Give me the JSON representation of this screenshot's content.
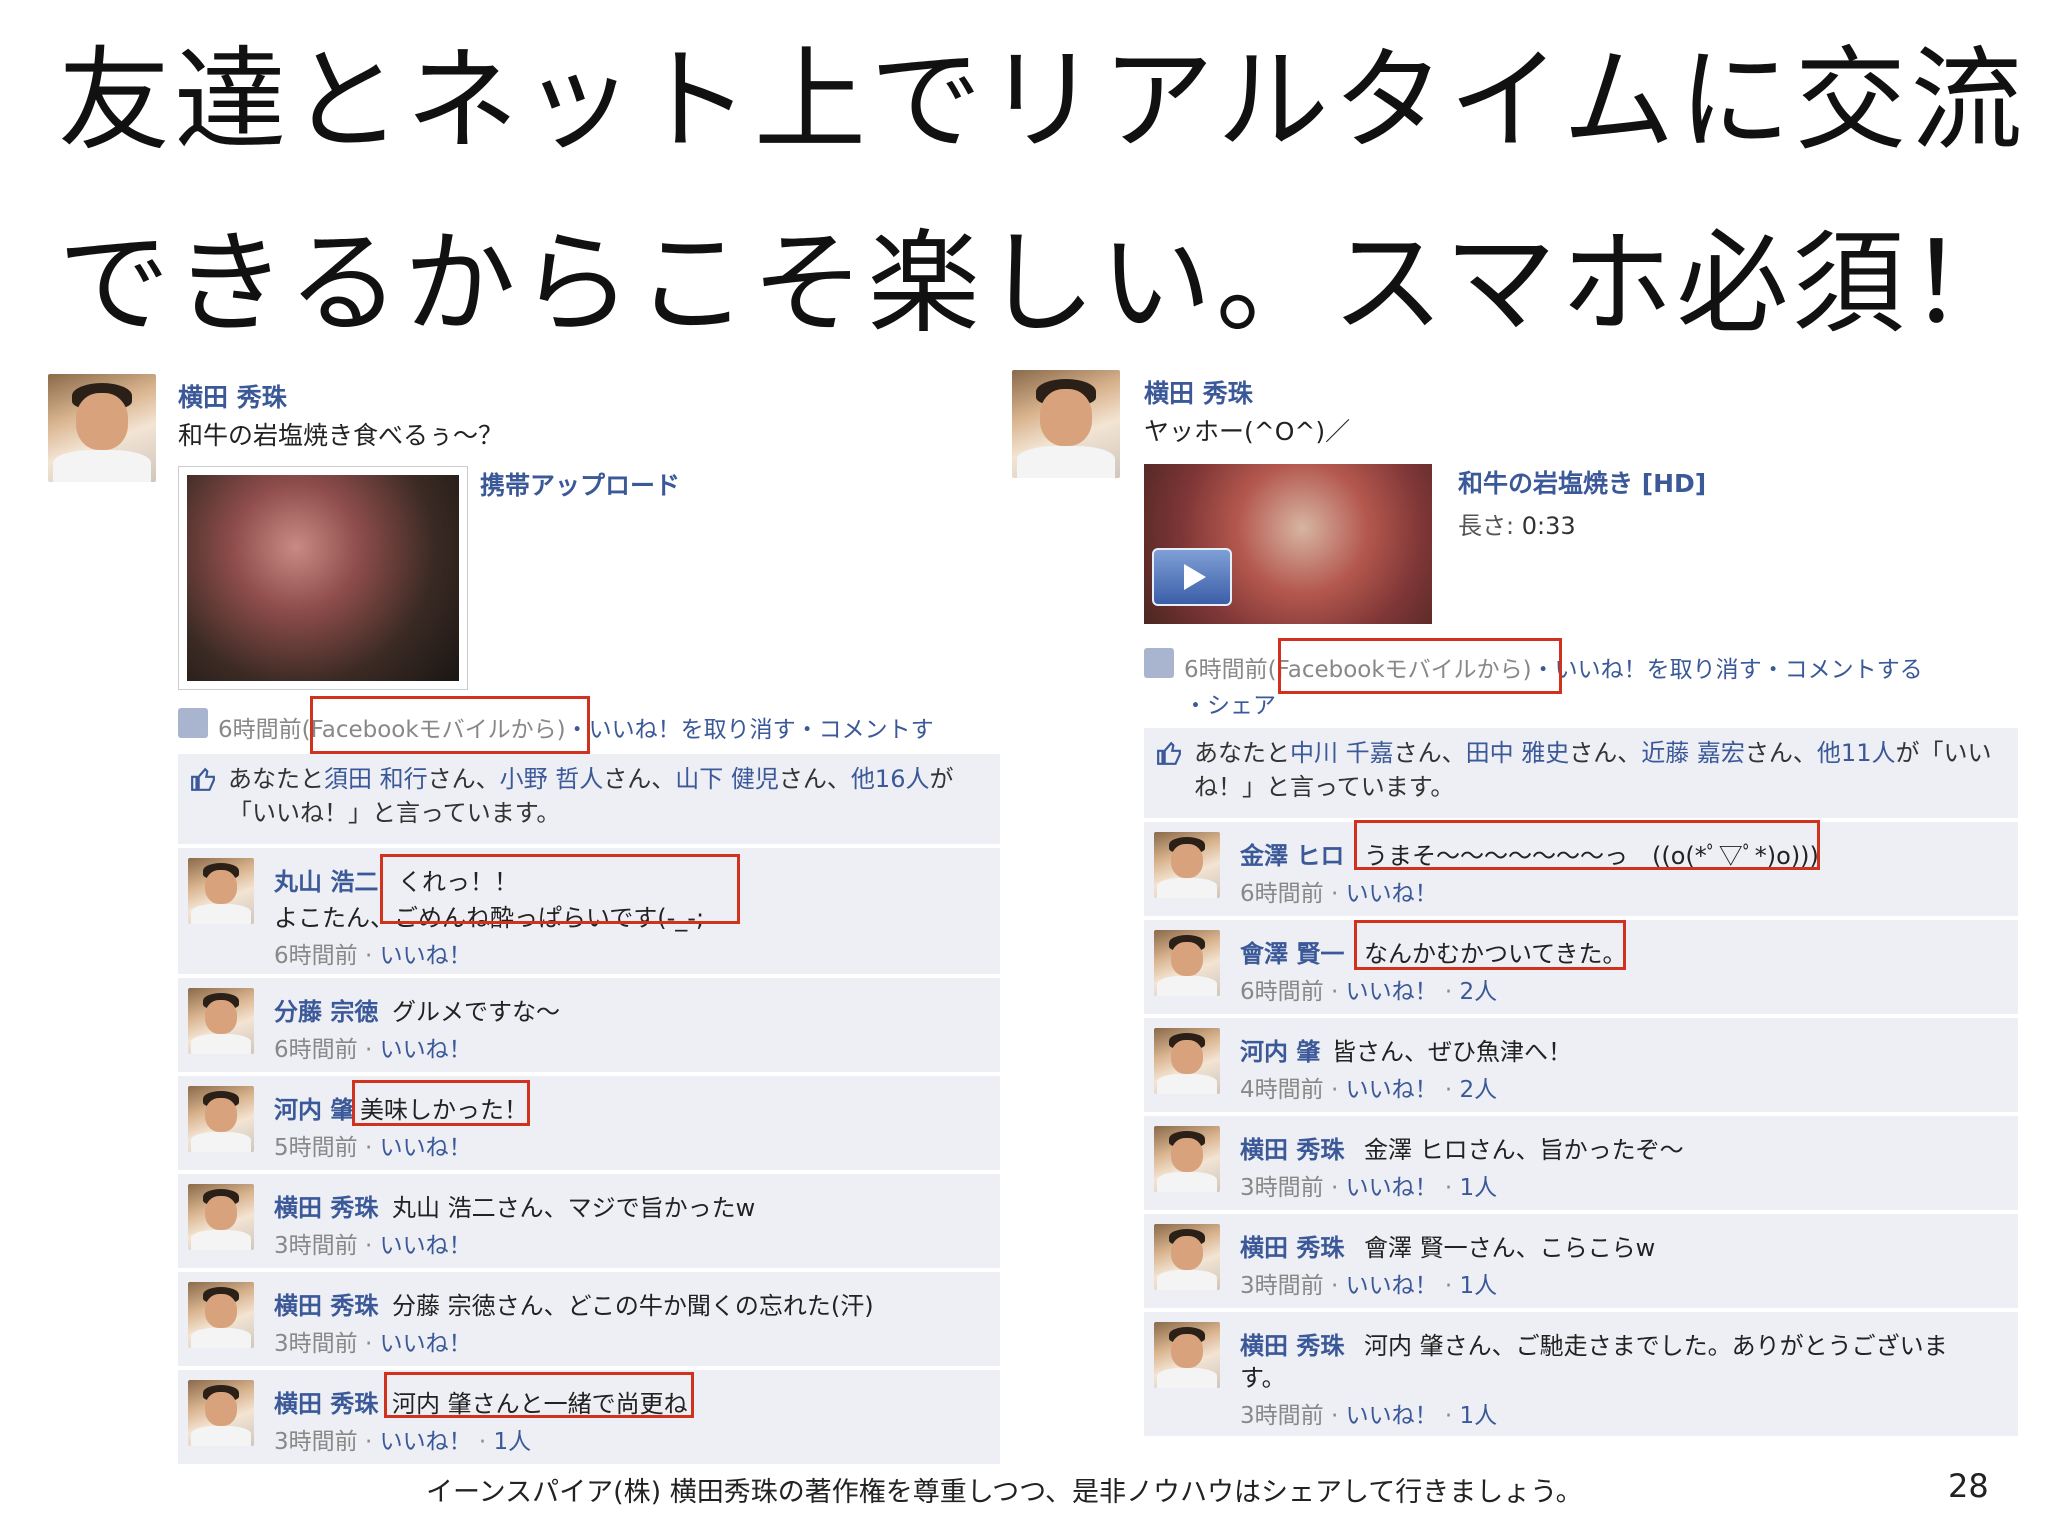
{
  "slide": {
    "title_line1": "友達とネット上でリアルタイムに交流",
    "title_line2": "できるからこそ楽しい。スマホ必須！",
    "footer": "イーンスパイア(株) 横田秀珠の著作権を尊重しつつ、是非ノウハウはシェアして行きましょう。",
    "page_number": "28"
  },
  "colors": {
    "link": "#3b5998",
    "highlight": "#d0321e",
    "comment_bg": "#edeff4"
  },
  "left_post": {
    "author": "横田 秀珠",
    "message": "和牛の岩塩焼き食べるぅ～？",
    "attachment_label": "携帯アップロード",
    "time": "6時間前",
    "via": "(Facebookモバイルから)",
    "actions": "・いいね！を取り消す・コメントす",
    "likes": {
      "prefix": "あなたと",
      "name1": "須田 和行",
      "sep1": "さん、",
      "name2": "小野 哲人",
      "sep2": "さん、",
      "name3": "山下 健児",
      "sep3": "さん、",
      "others": "他16人",
      "suffix": "が「いいね！」と言っています。"
    },
    "comments": [
      {
        "name": "丸山 浩二",
        "text": "くれっ！！",
        "text2": "よこたん、ごめんね酔っぱらいです(-_-;",
        "meta_time": "6時間前",
        "meta_like": "いいね！",
        "meta_count": ""
      },
      {
        "name": "分藤 宗徳",
        "text": "グルメですな～",
        "meta_time": "6時間前",
        "meta_like": "いいね！",
        "meta_count": ""
      },
      {
        "name": "河内 肇",
        "text": "美味しかった！",
        "meta_time": "5時間前",
        "meta_like": "いいね！",
        "meta_count": ""
      },
      {
        "name": "横田 秀珠",
        "text": "丸山 浩二さん、マジで旨かったw",
        "meta_time": "3時間前",
        "meta_like": "いいね！",
        "meta_count": ""
      },
      {
        "name": "横田 秀珠",
        "text": "分藤 宗徳さん、どこの牛か聞くの忘れた(汗)",
        "meta_time": "3時間前",
        "meta_like": "いいね！",
        "meta_count": ""
      },
      {
        "name": "横田 秀珠",
        "text": "河内 肇さんと一緒で尚更ね",
        "meta_time": "3時間前",
        "meta_like": "いいね！",
        "meta_count": "1人"
      }
    ]
  },
  "right_post": {
    "author": "横田 秀珠",
    "message": "ヤッホー(^O^)／",
    "video_title": "和牛の岩塩焼き [HD]",
    "length_label": "長さ:",
    "length_value": "0:33",
    "time": "6時間前",
    "via": "(Facebookモバイルから)",
    "actions": "・いいね！を取り消す・コメントする",
    "actions2": "・シェア",
    "likes": {
      "prefix": "あなたと",
      "name1": "中川 千嘉",
      "sep1": "さん、",
      "name2": "田中 雅史",
      "sep2": "さん、",
      "name3": "近藤 嘉宏",
      "sep3": "さん、",
      "others": "他11人",
      "suffix": "が「いいね！」と言っています。"
    },
    "comments": [
      {
        "name": "金澤 ヒロ",
        "text": "うまそ～～～～～～～っ　((o(*ﾟ▽ﾟ*)o)))",
        "meta_time": "6時間前",
        "meta_like": "いいね！",
        "meta_count": ""
      },
      {
        "name": "會澤 賢一",
        "text": "なんかむかついてきた。",
        "meta_time": "6時間前",
        "meta_like": "いいね！",
        "meta_count": "2人"
      },
      {
        "name": "河内 肇",
        "text": "皆さん、ぜひ魚津へ！",
        "meta_time": "4時間前",
        "meta_like": "いいね！",
        "meta_count": "2人"
      },
      {
        "name": "横田 秀珠",
        "text": "金澤 ヒロさん、旨かったぞ～",
        "meta_time": "3時間前",
        "meta_like": "いいね！",
        "meta_count": "1人"
      },
      {
        "name": "横田 秀珠",
        "text": "會澤 賢一さん、こらこらw",
        "meta_time": "3時間前",
        "meta_like": "いいね！",
        "meta_count": "1人"
      },
      {
        "name": "横田 秀珠",
        "text": "河内 肇さん、ご馳走さまでした。ありがとうございま",
        "text2": "す。",
        "meta_time": "3時間前",
        "meta_like": "いいね！",
        "meta_count": "1人"
      }
    ]
  }
}
